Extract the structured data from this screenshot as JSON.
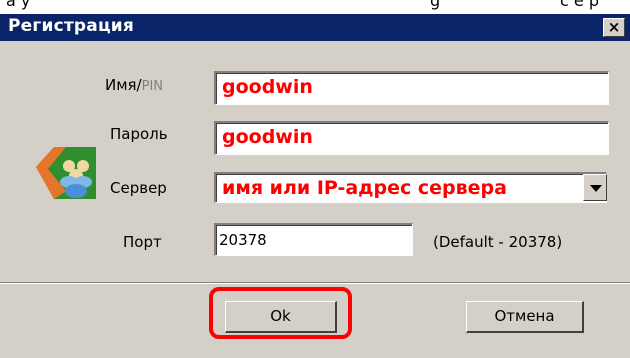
{
  "top_text": "ау                                                                                         g  сервер",
  "dialog": {
    "title": "Регистрация",
    "close_glyph": "×",
    "icon": "users-app-icon"
  },
  "fields": {
    "name_label": "Имя/",
    "pin_label": "PIN",
    "name_value": "goodwin",
    "password_label": "Пароль",
    "password_value": "goodwin",
    "server_label": "Сервер",
    "server_value": "имя или IP-адрес сервера",
    "port_label": "Порт",
    "port_value": "20378",
    "port_default_note": "(Default - 20378)"
  },
  "buttons": {
    "ok_label": "Ok",
    "cancel_label": "Отмена"
  },
  "colors": {
    "title_bar": "#0a246a",
    "window_bg": "#d4d0c8",
    "annotation_red": "#ff0000"
  }
}
